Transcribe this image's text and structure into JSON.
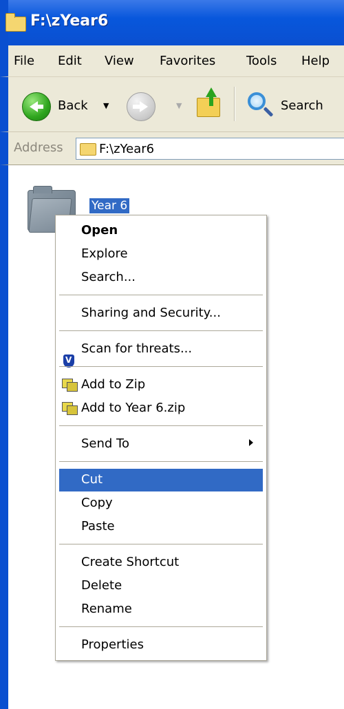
{
  "window": {
    "title": "F:\\zYear6"
  },
  "menubar": [
    "File",
    "Edit",
    "View",
    "Favorites",
    "Tools",
    "Help"
  ],
  "toolbar": {
    "back_label": "Back",
    "search_label": "Search"
  },
  "address": {
    "label": "Address",
    "value": "F:\\zYear6"
  },
  "folder": {
    "name": "Year 6"
  },
  "context_menu": {
    "open": "Open",
    "explore": "Explore",
    "search": "Search...",
    "sharing": "Sharing and Security...",
    "scan": "Scan for threats...",
    "add_zip": "Add to Zip",
    "add_named_zip": "Add to Year 6.zip",
    "send_to": "Send To",
    "cut": "Cut",
    "copy": "Copy",
    "paste": "Paste",
    "create_shortcut": "Create Shortcut",
    "delete": "Delete",
    "rename": "Rename",
    "properties": "Properties",
    "selected_item": "Cut"
  },
  "colors": {
    "titlebar": "#0857dc",
    "menu_face": "#ece9d8",
    "selection": "#316ac5"
  }
}
